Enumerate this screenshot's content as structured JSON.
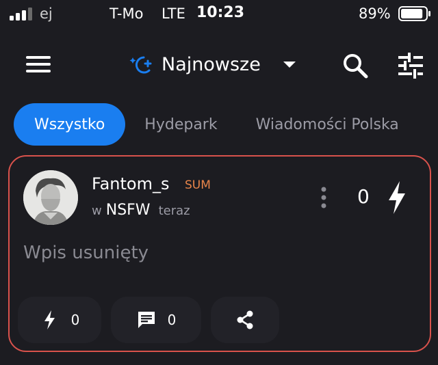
{
  "status_bar": {
    "carrier_fragment": "ej",
    "carrier": "T-Mo",
    "network": "LTE",
    "time": "10:23",
    "battery_percent": "89%",
    "battery_level": 0.89
  },
  "navbar": {
    "sort_label": "Najnowsze",
    "accent": "#1a7ef0"
  },
  "tabs": [
    {
      "label": "Wszystko",
      "active": true
    },
    {
      "label": "Hydepark",
      "active": false
    },
    {
      "label": "Wiadomości Polska",
      "active": false
    }
  ],
  "post": {
    "author": "Fantom_s",
    "author_badge": "SUM",
    "community_prefix": "w",
    "community": "NSFW",
    "time": "teraz",
    "vote_count": "0",
    "body": "Wpis usunięty",
    "actions": {
      "zap_count": "0",
      "comment_count": "0"
    },
    "border_color": "#d9524c"
  }
}
